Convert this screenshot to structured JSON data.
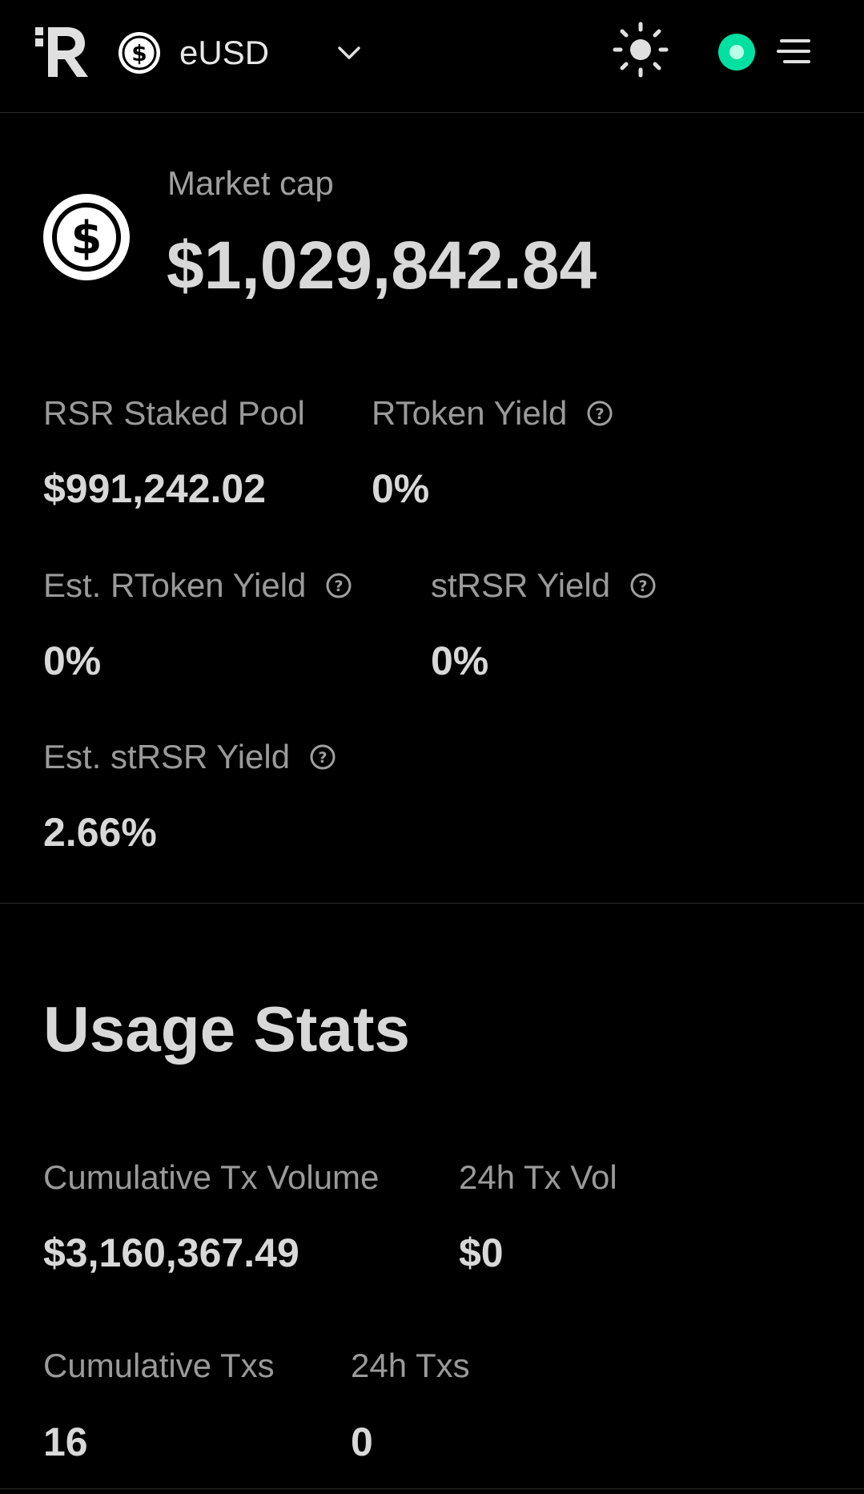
{
  "header": {
    "token_name": "eUSD",
    "icons": {
      "logo": "reserve-logo-icon",
      "token": "dollar-coin-icon",
      "chevron": "chevron-down-icon",
      "theme": "sun-icon",
      "status": "wallet-status-icon",
      "menu": "menu-icon"
    },
    "status_color": "#00e0a0"
  },
  "market_cap": {
    "label": "Market cap",
    "value": "$1,029,842.84"
  },
  "overview": {
    "rsr_staked_pool": {
      "label": "RSR Staked Pool",
      "value": "$991,242.02"
    },
    "rtoken_yield": {
      "label": "RToken Yield",
      "value": "0%"
    },
    "est_rtoken_yield": {
      "label": "Est. RToken Yield",
      "value": "0%"
    },
    "strsr_yield": {
      "label": "stRSR Yield",
      "value": "0%"
    },
    "est_strsr_yield": {
      "label": "Est. stRSR Yield",
      "value": "2.66%"
    }
  },
  "usage": {
    "title": "Usage Stats",
    "cumulative_tx_volume": {
      "label": "Cumulative Tx Volume",
      "value": "$3,160,367.49"
    },
    "tx_vol_24h": {
      "label": "24h Tx Vol",
      "value": "$0"
    },
    "cumulative_txs": {
      "label": "Cumulative Txs",
      "value": "16"
    },
    "txs_24h": {
      "label": "24h Txs",
      "value": "0"
    }
  }
}
